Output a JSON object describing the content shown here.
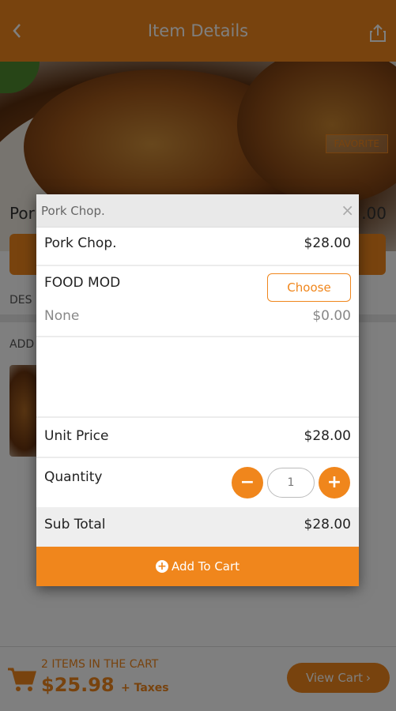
{
  "header": {
    "title": "Item Details",
    "back_icon": "chevron-left-icon",
    "share_icon": "share-icon"
  },
  "item": {
    "favorite_label": "FAVORITE"
  },
  "page": {
    "name_partial": "Por",
    "price_partial": ".00",
    "description_label": "DES",
    "addons_label": "ADD"
  },
  "footer": {
    "cart_count": "2 ITEMS IN THE CART",
    "cart_total": "$25.98",
    "taxes": "+ Taxes",
    "view_cart_label": "View Cart",
    "view_cart_chevron": "›"
  },
  "modal": {
    "title": "Pork Chop.",
    "close": "×",
    "item_name": "Pork Chop.",
    "item_price": "$28.00",
    "mod_label": "FOOD MOD",
    "choose_label": "Choose",
    "mod_value": "None",
    "mod_price": "$0.00",
    "unit_price_label": "Unit Price",
    "unit_price_value": "$28.00",
    "quantity_label": "Quantity",
    "quantity_minus": "−",
    "quantity_value": "1",
    "quantity_plus": "+",
    "subtotal_label": "Sub Total",
    "subtotal_value": "$28.00",
    "add_to_cart_label": "Add To Cart",
    "add_icon": "+"
  },
  "colors": {
    "accent": "#f0861c",
    "overlay": "rgba(0,0,0,0.5)"
  }
}
